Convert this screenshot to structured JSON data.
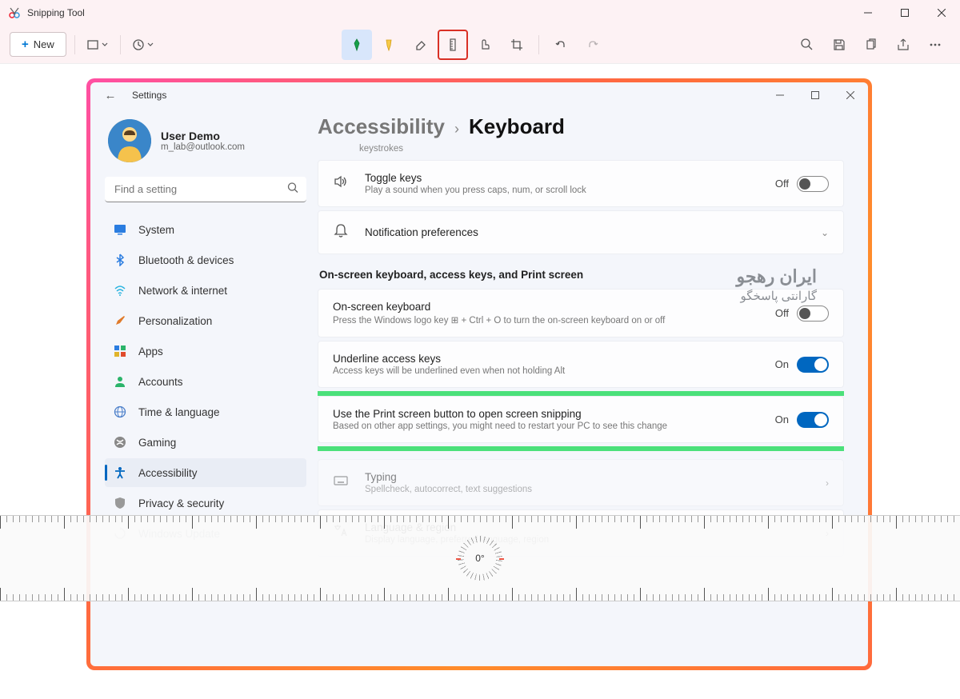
{
  "outer": {
    "appTitle": "Snipping Tool",
    "newLabel": "New"
  },
  "inner": {
    "windowTitle": "Settings",
    "user": {
      "name": "User Demo",
      "email": "m_lab@outlook.com"
    },
    "searchPlaceholder": "Find a setting",
    "nav": [
      {
        "label": "System"
      },
      {
        "label": "Bluetooth & devices"
      },
      {
        "label": "Network & internet"
      },
      {
        "label": "Personalization"
      },
      {
        "label": "Apps"
      },
      {
        "label": "Accounts"
      },
      {
        "label": "Time & language"
      },
      {
        "label": "Gaming"
      },
      {
        "label": "Accessibility"
      },
      {
        "label": "Privacy & security"
      },
      {
        "label": "Windows Update"
      }
    ],
    "breadcrumb": {
      "parent": "Accessibility",
      "current": "Keyboard"
    },
    "hintKeystrokes": "keystrokes",
    "cards": {
      "toggleKeys": {
        "title": "Toggle keys",
        "sub": "Play a sound when you press caps, num, or scroll lock",
        "state": "Off"
      },
      "notifPrefs": {
        "title": "Notification preferences"
      },
      "sectionOnscreen": "On-screen keyboard, access keys, and Print screen",
      "osk": {
        "title": "On-screen keyboard",
        "sub": "Press the Windows logo key ⊞ + Ctrl + O to turn the on-screen keyboard on or off",
        "state": "Off"
      },
      "underline": {
        "title": "Underline access keys",
        "sub": "Access keys will be underlined even when not holding Alt",
        "state": "On"
      },
      "printscreen": {
        "title": "Use the Print screen button to open screen snipping",
        "sub": "Based on other app settings, you might need to restart your PC to see this change",
        "state": "On"
      },
      "typing": {
        "title": "Typing",
        "sub": "Spellcheck, autocorrect, text suggestions"
      },
      "langRegion": {
        "title": "Language & region",
        "sub": "Display language, preferred language, region"
      }
    }
  },
  "ruler": {
    "angle": "0°"
  },
  "watermark": {
    "line1": "ایران رهجو",
    "line2": "گارانتی پاسخگو"
  }
}
